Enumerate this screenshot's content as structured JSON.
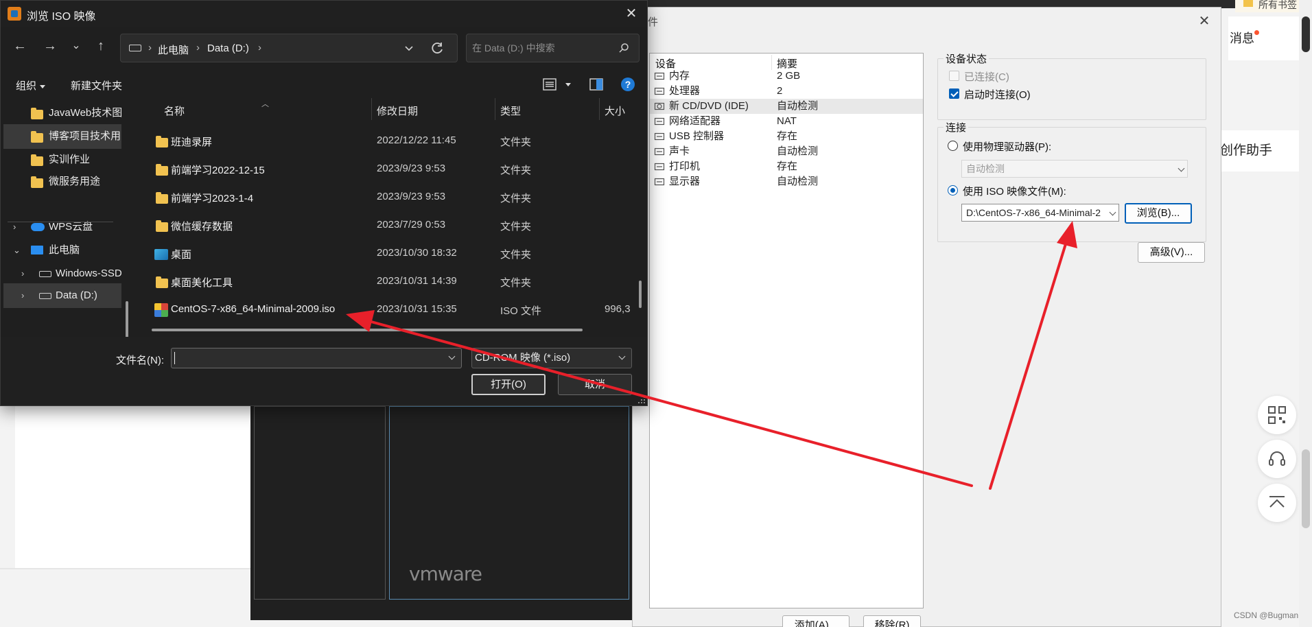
{
  "background": {
    "bookmark": "所有书签",
    "messages": "消息",
    "assistant": "创作助手",
    "watermark": "CSDN @Bugman"
  },
  "vmware": {
    "logo": "vmware"
  },
  "vm_settings": {
    "title_fragment": "件",
    "close": "✕",
    "device_header": "设备",
    "summary_header": "摘要",
    "devices": [
      {
        "name": "内存",
        "value": "2 GB",
        "icon": "memory-icon"
      },
      {
        "name": "处理器",
        "value": "2",
        "icon": "cpu-icon"
      },
      {
        "name": "新 CD/DVD (IDE)",
        "value": "自动检测",
        "icon": "cd-dvd-icon"
      },
      {
        "name": "网络适配器",
        "value": "NAT",
        "icon": "network-icon"
      },
      {
        "name": "USB 控制器",
        "value": "存在",
        "icon": "usb-icon"
      },
      {
        "name": "声卡",
        "value": "自动检测",
        "icon": "sound-card-icon"
      },
      {
        "name": "打印机",
        "value": "存在",
        "icon": "printer-icon"
      },
      {
        "name": "显示器",
        "value": "自动检测",
        "icon": "display-icon"
      }
    ],
    "device_status": {
      "title": "设备状态",
      "connected": "已连接(C)",
      "connect_at_power_on": "启动时连接(O)"
    },
    "connection": {
      "title": "连接",
      "use_physical": "使用物理驱动器(P):",
      "physical_value": "自动检测",
      "use_iso": "使用 ISO 映像文件(M):",
      "iso_path": "D:\\CentOS-7-x86_64-Minimal-2",
      "browse": "浏览(B)..."
    },
    "advanced": "高级(V)...",
    "add": "添加(A)...",
    "remove": "移除(R)"
  },
  "iso_dialog": {
    "title": "浏览 ISO 映像",
    "close": "✕",
    "nav": {
      "back": "←",
      "forward": "→",
      "recent": "⌄",
      "up": "↑"
    },
    "breadcrumbs": [
      "此电脑",
      "Data (D:)"
    ],
    "breadcrumb_sep": "›",
    "search_placeholder": "在 Data (D:) 中搜索",
    "toolbar": {
      "organize": "组织",
      "new_folder": "新建文件夹",
      "help": "?"
    },
    "nav_items": [
      {
        "label": "JavaWeb技术图",
        "kind": "folder",
        "selected": false
      },
      {
        "label": "博客项目技术用",
        "kind": "folder",
        "selected": true
      },
      {
        "label": "实训作业",
        "kind": "folder",
        "selected": false
      },
      {
        "label": "微服务用途",
        "kind": "folder",
        "selected": false
      },
      {
        "label": "WPS云盘",
        "kind": "cloud",
        "selected": false,
        "chevron": "›"
      },
      {
        "label": "此电脑",
        "kind": "pc",
        "selected": false,
        "chevron": "⌄"
      },
      {
        "label": "Windows-SSD",
        "kind": "drive",
        "selected": false,
        "chevron": "›"
      },
      {
        "label": "Data (D:)",
        "kind": "drive",
        "selected": true,
        "chevron": "›"
      }
    ],
    "columns": {
      "name": "名称",
      "date": "修改日期",
      "type": "类型",
      "size": "大小"
    },
    "files": [
      {
        "name": "班迪录屏",
        "date": "2022/12/22 11:45",
        "type": "文件夹",
        "size": "",
        "kind": "folder"
      },
      {
        "name": "前端学习2022-12-15",
        "date": "2023/9/23 9:53",
        "type": "文件夹",
        "size": "",
        "kind": "folder"
      },
      {
        "name": "前端学习2023-1-4",
        "date": "2023/9/23 9:53",
        "type": "文件夹",
        "size": "",
        "kind": "folder"
      },
      {
        "name": "微信缓存数据",
        "date": "2023/7/29 0:53",
        "type": "文件夹",
        "size": "",
        "kind": "folder"
      },
      {
        "name": "桌面",
        "date": "2023/10/30 18:32",
        "type": "文件夹",
        "size": "",
        "kind": "desktop"
      },
      {
        "name": "桌面美化工具",
        "date": "2023/10/31 14:39",
        "type": "文件夹",
        "size": "",
        "kind": "folder"
      },
      {
        "name": "CentOS-7-x86_64-Minimal-2009.iso",
        "date": "2023/10/31 15:35",
        "type": "ISO 文件",
        "size": "996,3",
        "kind": "iso"
      }
    ],
    "filename_label": "文件名(N):",
    "filename_value": "",
    "filter": "CD-ROM 映像 (*.iso)",
    "open": "打开(O)",
    "cancel": "取消"
  },
  "annotation_color": "#e8202a"
}
